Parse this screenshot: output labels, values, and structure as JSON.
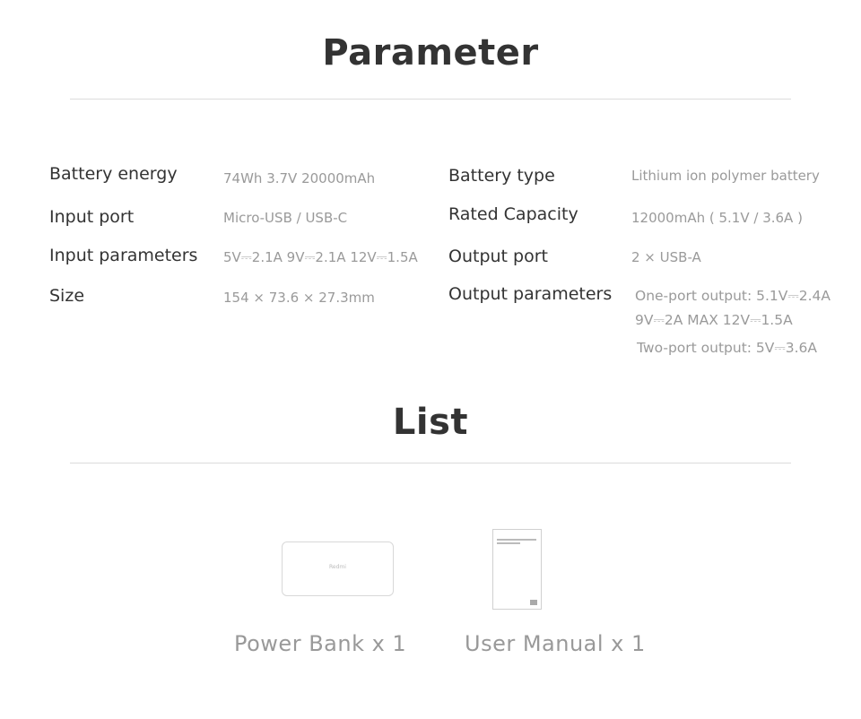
{
  "parameter": {
    "title": "Parameter",
    "left": [
      {
        "label": "Battery energy",
        "value": "74Wh 3.7V  20000mAh"
      },
      {
        "label": "Input port",
        "value": "Micro-USB / USB-C"
      },
      {
        "label": "Input parameters",
        "value": "5V⎓2.1A  9V⎓2.1A  12V⎓1.5A"
      },
      {
        "label": "Size",
        "value": "154 × 73.6 × 27.3mm"
      }
    ],
    "right": [
      {
        "label": "Battery type",
        "value": "Lithium ion polymer battery"
      },
      {
        "label": "Rated Capacity",
        "value": "12000mAh ( 5.1V / 3.6A )"
      },
      {
        "label": "Output port",
        "value": "2 × USB-A"
      },
      {
        "label": "Output parameters",
        "value": "One-port output: 5.1V⎓2.4A",
        "value2": "9V⎓2A MAX    12V⎓1.5A",
        "value3": "Two-port output: 5V⎓3.6A"
      }
    ]
  },
  "list": {
    "title": "List",
    "items": [
      {
        "label": "Power Bank  x 1",
        "logo_text": "Redmi"
      },
      {
        "label": "User Manual  x 1"
      }
    ]
  }
}
